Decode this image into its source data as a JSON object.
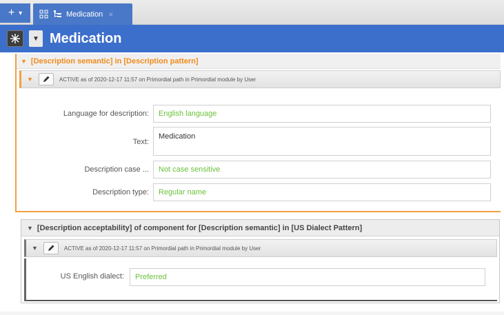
{
  "tab_controls": {
    "add": "+",
    "menu": "▾"
  },
  "tab": {
    "label": "Medication",
    "close": "×"
  },
  "titlebar": {
    "title": "Medication"
  },
  "outer_section": {
    "title": "[Description semantic] in [Description pattern]",
    "version_text": "ACTIVE as of 2020-12-17 11:57 on Primordial path in Primordial module by User",
    "fields": [
      {
        "label": "Language for description:",
        "value": "English language"
      },
      {
        "label": "Text:",
        "value": "Medication"
      },
      {
        "label": "Description case ...",
        "value": "Not case sensitive"
      },
      {
        "label": "Description type:",
        "value": "Regular name"
      }
    ]
  },
  "inner_section": {
    "title": "[Description acceptability] of component for [Description semantic] in [US Dialect Pattern]",
    "version_text": "ACTIVE as of 2020-12-17 11:57 on Primordial path in Primordial module by User",
    "field": {
      "label": "US English dialect:",
      "value": "Preferred"
    }
  },
  "colors": {
    "accent_blue": "#3c6fcb",
    "accent_orange": "#f08a1c",
    "value_green": "#6ac13a"
  }
}
